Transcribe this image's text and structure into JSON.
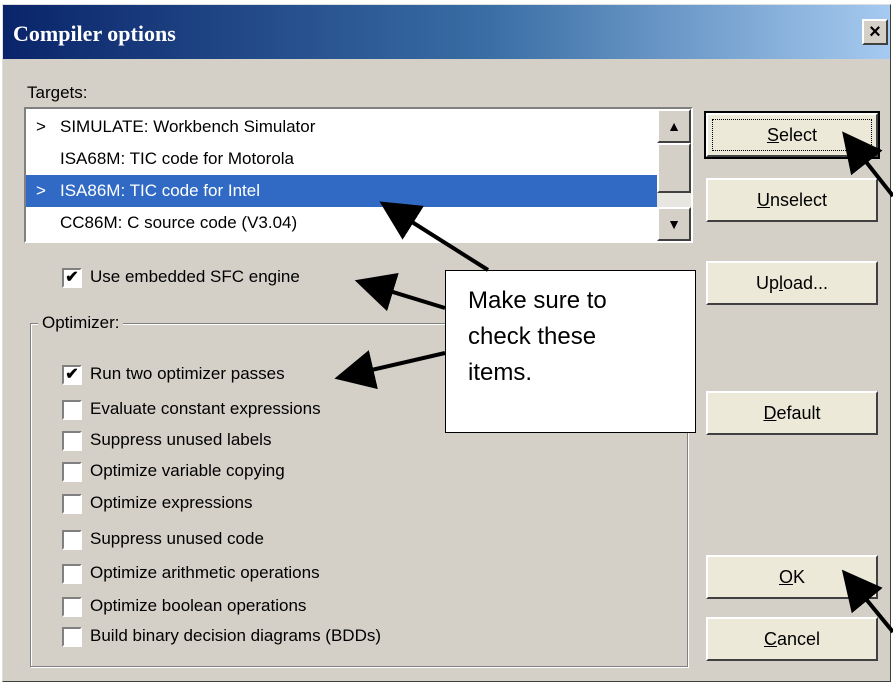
{
  "window": {
    "title": "Compiler options",
    "close_label": "×"
  },
  "targets": {
    "label": "Targets:",
    "items": [
      {
        "mark": ">",
        "label": "SIMULATE: Workbench Simulator",
        "selected": false
      },
      {
        "mark": "",
        "label": "ISA68M: TIC code for Motorola",
        "selected": false
      },
      {
        "mark": ">",
        "label": "ISA86M: TIC code for Intel",
        "selected": true
      },
      {
        "mark": "",
        "label": "CC86M: C source code (V3.04)",
        "selected": false
      }
    ],
    "scroll_up": "▲",
    "scroll_down": "▼"
  },
  "buttons": {
    "select": {
      "pre": "",
      "key": "S",
      "post": "elect"
    },
    "unselect": {
      "pre": "",
      "key": "U",
      "post": "nselect"
    },
    "upload": {
      "pre": "Up",
      "key": "l",
      "post": "oad..."
    },
    "default": {
      "pre": "",
      "key": "D",
      "post": "efault"
    },
    "ok": {
      "pre": "",
      "key": "O",
      "post": "K"
    },
    "cancel": {
      "pre": "",
      "key": "C",
      "post": "ancel"
    }
  },
  "embedded_sfc": {
    "label": "Use embedded SFC engine",
    "checked": true,
    "check_glyph": "✔"
  },
  "optimizer": {
    "caption": "Optimizer:",
    "options": [
      {
        "label": "Run two optimizer passes",
        "checked": true
      },
      {
        "label": "Evaluate constant expressions",
        "checked": false
      },
      {
        "label": "Suppress unused labels",
        "checked": false
      },
      {
        "label": "Optimize variable copying",
        "checked": false
      },
      {
        "label": "Optimize expressions",
        "checked": false
      },
      {
        "label": "Suppress unused code",
        "checked": false
      },
      {
        "label": "Optimize arithmetic operations",
        "checked": false
      },
      {
        "label": "Optimize boolean operations",
        "checked": false
      },
      {
        "label": "Build binary decision diagrams (BDDs)",
        "checked": false
      }
    ]
  },
  "callout": {
    "lines": [
      "Make sure to",
      "check these",
      "items."
    ]
  }
}
